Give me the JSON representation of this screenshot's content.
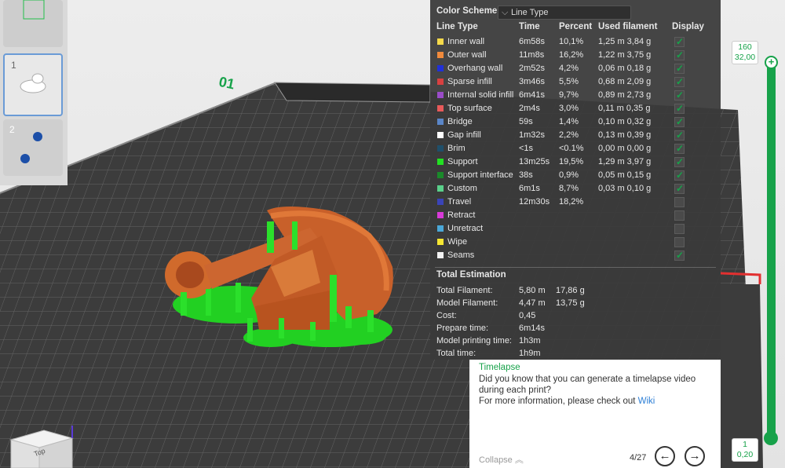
{
  "plate_thumbnails": [
    {
      "number": "1",
      "selected": true
    },
    {
      "number": "2",
      "selected": false
    }
  ],
  "viewport": {
    "plate_label": "01",
    "view_cube_label": "Top"
  },
  "legend": {
    "scheme_label": "Color Scheme",
    "scheme_value": "Line Type",
    "headers": {
      "line_type": "Line Type",
      "time": "Time",
      "percent": "Percent",
      "used_filament": "Used filament",
      "display": "Display"
    },
    "rows": [
      {
        "name": "Inner wall",
        "color": "#f5d94a",
        "time": "6m58s",
        "percent": "10,1%",
        "used": "1,25 m  3,84 g",
        "display": true
      },
      {
        "name": "Outer wall",
        "color": "#f08a3c",
        "time": "11m8s",
        "percent": "16,2%",
        "used": "1,22 m  3,75 g",
        "display": true
      },
      {
        "name": "Overhang wall",
        "color": "#2030d8",
        "time": "2m52s",
        "percent": "4,2%",
        "used": "0,06 m  0,18 g",
        "display": true
      },
      {
        "name": "Sparse infill",
        "color": "#d84040",
        "time": "3m46s",
        "percent": "5,5%",
        "used": "0,68 m  2,09 g",
        "display": true
      },
      {
        "name": "Internal solid infill",
        "color": "#9a4cc8",
        "time": "6m41s",
        "percent": "9,7%",
        "used": "0,89 m  2,73 g",
        "display": true
      },
      {
        "name": "Top surface",
        "color": "#e85a5a",
        "time": "2m4s",
        "percent": "3,0%",
        "used": "0,11 m  0,35 g",
        "display": true
      },
      {
        "name": "Bridge",
        "color": "#5a86c8",
        "time": "59s",
        "percent": "1,4%",
        "used": "0,10 m  0,32 g",
        "display": true
      },
      {
        "name": "Gap infill",
        "color": "#ffffff",
        "time": "1m32s",
        "percent": "2,2%",
        "used": "0,13 m  0,39 g",
        "display": true
      },
      {
        "name": "Brim",
        "color": "#1f4f6a",
        "time": "<1s",
        "percent": "<0.1%",
        "used": "0,00 m  0,00 g",
        "display": true
      },
      {
        "name": "Support",
        "color": "#22e022",
        "time": "13m25s",
        "percent": "19,5%",
        "used": "1,29 m  3,97 g",
        "display": true
      },
      {
        "name": "Support interface",
        "color": "#1a8a2a",
        "time": "38s",
        "percent": "0,9%",
        "used": "0,05 m  0,15 g",
        "display": true
      },
      {
        "name": "Custom",
        "color": "#5ad08a",
        "time": "6m1s",
        "percent": "8,7%",
        "used": "0,03 m  0,10 g",
        "display": true
      },
      {
        "name": "Travel",
        "color": "#3a44b8",
        "time": "12m30s",
        "percent": "18,2%",
        "used": "",
        "display": false
      },
      {
        "name": "Retract",
        "color": "#d83ad8",
        "time": "",
        "percent": "",
        "used": "",
        "display": false
      },
      {
        "name": "Unretract",
        "color": "#4aa8d8",
        "time": "",
        "percent": "",
        "used": "",
        "display": false
      },
      {
        "name": "Wipe",
        "color": "#f5e632",
        "time": "",
        "percent": "",
        "used": "",
        "display": false
      },
      {
        "name": "Seams",
        "color": "#f2f2f2",
        "time": "",
        "percent": "",
        "used": "",
        "display": true
      }
    ],
    "total_title": "Total Estimation",
    "totals": [
      {
        "label": "Total Filament:",
        "v1": "5,80 m",
        "v2": "17,86 g"
      },
      {
        "label": "Model Filament:",
        "v1": "4,47 m",
        "v2": "13,75 g"
      },
      {
        "label": "Cost:",
        "v1": "0,45",
        "v2": ""
      },
      {
        "label": "Prepare time:",
        "v1": "6m14s",
        "v2": ""
      },
      {
        "label": "Model printing time:",
        "v1": "1h3m",
        "v2": ""
      },
      {
        "label": "Total time:",
        "v1": "1h9m",
        "v2": ""
      }
    ]
  },
  "tips": {
    "title": "Timelapse",
    "body_line1": "Did you know that you can generate a timelapse video",
    "body_line2": "during each print?",
    "body_line3": "For more information, please check out ",
    "link": "Wiki",
    "collapse": "Collapse",
    "page": "4/27",
    "prev": "←",
    "next": "→"
  },
  "slider": {
    "top_layer": "160",
    "top_height": "32,00",
    "bottom_layer": "1",
    "bottom_height": "0,20"
  },
  "colors": {
    "accent": "#17a24a",
    "support": "#22e022",
    "model": "#d8702a"
  }
}
